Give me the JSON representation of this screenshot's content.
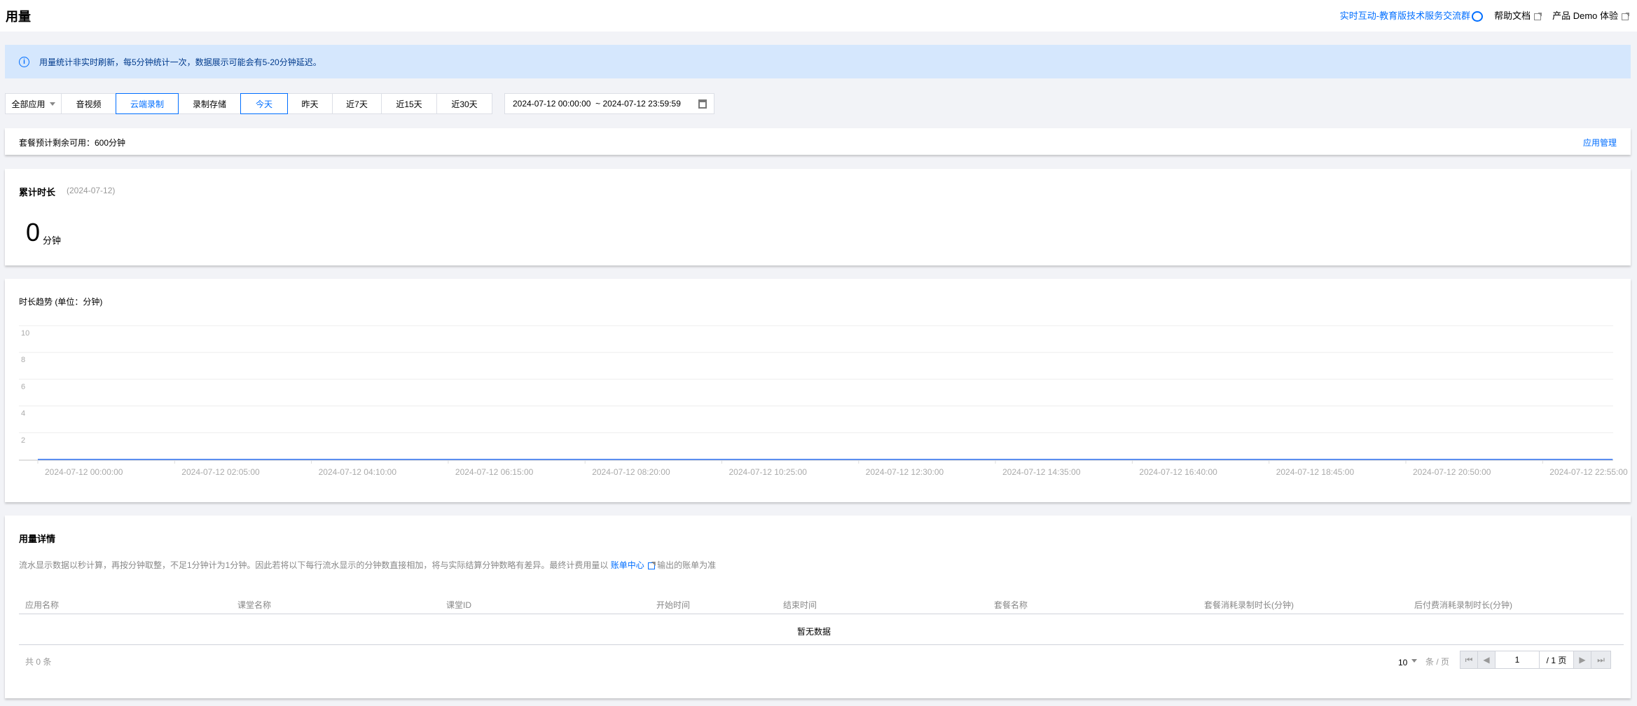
{
  "header": {
    "title": "用量",
    "links": [
      {
        "label": "实时互动-教育版技术服务交流群",
        "icon": "chat-icon"
      },
      {
        "label": "帮助文档",
        "icon": "external-link-icon"
      },
      {
        "label": "产品 Demo 体验",
        "icon": "external-link-icon"
      }
    ]
  },
  "banner": {
    "text": "用量统计非实时刷新，每5分钟统计一次，数据展示可能会有5-20分钟延迟。"
  },
  "filters": {
    "app_select": "全部应用",
    "types": [
      "音视频",
      "云端录制",
      "录制存储"
    ],
    "selected_type": "云端录制",
    "ranges": [
      "今天",
      "昨天",
      "近7天",
      "近15天",
      "近30天"
    ],
    "selected_range": "今天",
    "date_range": "2024-07-12 00:00:00  ~ 2024-07-12 23:59:59"
  },
  "package": {
    "text": "套餐预计剩余可用：600分钟",
    "manage_link": "应用管理"
  },
  "total": {
    "title": "累计时长",
    "date": "(2024-07-12)",
    "value": "0",
    "unit": "分钟"
  },
  "chart_title": "时长趋势 (单位：分钟)",
  "chart_data": {
    "type": "line",
    "title": "时长趋势 (单位：分钟)",
    "ylabel": "分钟",
    "ylim": [
      0,
      10
    ],
    "yticks": [
      "10",
      "8",
      "6",
      "4",
      "2"
    ],
    "grid": true,
    "xticks": [
      "2024-07-12 00:00:00",
      "2024-07-12 02:05:00",
      "2024-07-12 04:10:00",
      "2024-07-12 06:15:00",
      "2024-07-12 08:20:00",
      "2024-07-12 10:25:00",
      "2024-07-12 12:30:00",
      "2024-07-12 14:35:00",
      "2024-07-12 16:40:00",
      "2024-07-12 18:45:00",
      "2024-07-12 20:50:00",
      "2024-07-12 22:55:00"
    ],
    "series": [
      {
        "name": "时长",
        "color": "#2a6ef0",
        "x_minutes": [
          0,
          1439
        ],
        "values": [
          0,
          0
        ]
      }
    ]
  },
  "details": {
    "title": "用量详情",
    "desc_before": "流水显示数据以秒计算，再按分钟取整，不足1分钟计为1分钟。因此若将以下每行流水显示的分钟数直接相加，将与实际结算分钟数略有差异。最终计费用量以",
    "desc_link": "账单中心",
    "desc_after": "输出的账单为准",
    "columns": [
      "应用名称",
      "课堂名称",
      "课堂ID",
      "开始时间",
      "结束时间",
      "套餐名称",
      "套餐消耗录制时长(分钟)",
      "后付费消耗录制时长(分钟)"
    ],
    "empty": "暂无数据",
    "total": "共 0 条",
    "page_size": "10",
    "page_size_unit": "条 / 页",
    "page": "1",
    "page_total": "/ 1 页"
  }
}
